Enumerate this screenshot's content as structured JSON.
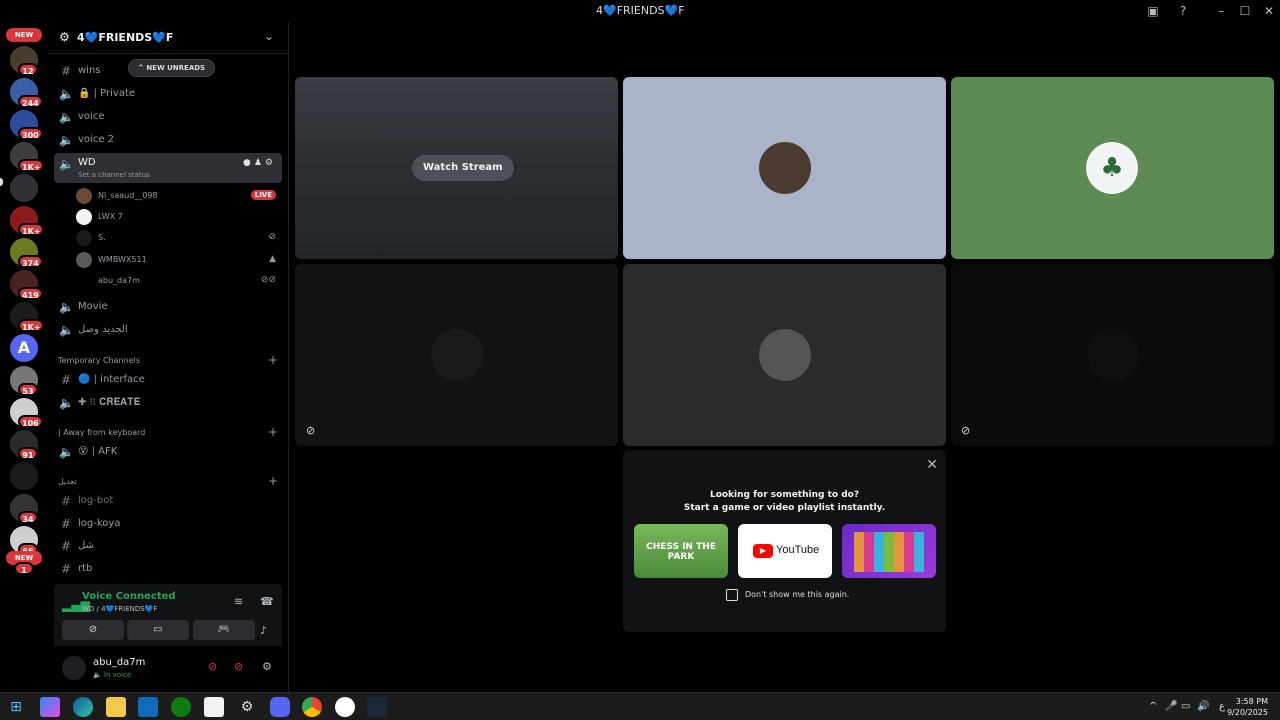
{
  "window": {
    "title": "4💙FRIENDS💙F",
    "controls": [
      "display-icon",
      "help-icon",
      "minimize-icon",
      "maximize-icon",
      "close-icon"
    ]
  },
  "rail": {
    "new_label": "NEW",
    "badges": [
      "12",
      "244",
      "300",
      "1K+",
      "1K+",
      "374",
      "419",
      "1K+",
      "53",
      "106",
      "91",
      "34",
      "66",
      "1"
    ]
  },
  "server": {
    "name": "4💙FRIENDS💙F"
  },
  "new_unreads_label": "NEW UNREADS",
  "channels": {
    "wins": "wins",
    "private": "🔒 | Private",
    "voice": "voice",
    "voice2": "voice 2",
    "wd": "WD",
    "wd_status": "Set a channel status",
    "movie": "Movie",
    "arabic": "الجديد وصل",
    "interface": "🔵 | interface",
    "create": "✚ ⁝⁝ 𝐂𝐑𝐄𝐀𝐓𝐄",
    "afk": "😵 | AFK",
    "logbot": "log-bot",
    "logkoya": "log-koya",
    "shel": "شل",
    "rtb": "rtb"
  },
  "members": [
    {
      "name": "Nl_saaud__098",
      "live": "LIVE"
    },
    {
      "name": "LWX 7"
    },
    {
      "name": "S."
    },
    {
      "name": "WMBWX511"
    },
    {
      "name": "abu_da7m"
    }
  ],
  "categories": {
    "temporary": "Temporary Channels",
    "away": "| Away from keyboard",
    "arabic": "تعديل"
  },
  "voice_panel": {
    "status": "Voice Connected",
    "path": "WD / 4💙FRIENDS💙F"
  },
  "user": {
    "name": "abu_da7m",
    "status": "In voice"
  },
  "stage": {
    "watch_label": "Watch Stream",
    "tile_colors": [
      "#2a2d31",
      "#a9b4c9",
      "#5d8b53",
      "#111214",
      "#2b2b2d",
      "#0b0b0c"
    ]
  },
  "activity": {
    "title": "Looking for something to do?",
    "subtitle": "Start a game or video playlist instantly.",
    "cards": [
      "CHESS IN THE PARK",
      "YouTube",
      "blocks"
    ],
    "dont_show": "Don't show me this again."
  },
  "taskbar": {
    "apps": [
      "windows-start",
      "copilot",
      "edge",
      "file-explorer",
      "outlook",
      "xbox",
      "store",
      "settings",
      "discord",
      "chrome",
      "steam-alt",
      "steam"
    ],
    "time": "3:58 PM",
    "date": "9/20/2025",
    "lang": "ع"
  }
}
